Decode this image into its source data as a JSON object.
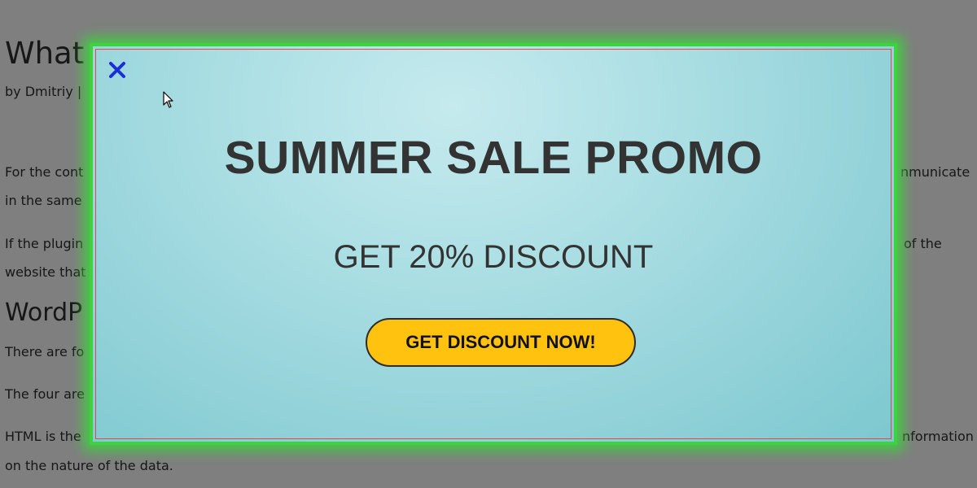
{
  "article": {
    "title_fragment": "What",
    "byline_fragment": "by Dmitriy  |",
    "p1_left": "For the cont",
    "p1_right": "nmunicate",
    "p1_line2": "in the same",
    "p2_left": "If the plugin",
    "p2_right": "of the",
    "p2_line2": "website that",
    "h2_fragment": "WordP",
    "p3_left": "There are fo",
    "p4_left": "The four are",
    "p5_left": "HTML is the",
    "p5_right": "nformation",
    "p5_line2": "on the nature of the data."
  },
  "popup": {
    "close_icon": "close-x-icon",
    "title": "SUMMER SALE PROMO",
    "subtitle": "GET 20% DISCOUNT",
    "cta_label": "GET DISCOUNT NOW!",
    "colors": {
      "glow_border": "#3ed23e",
      "inner_border": "#e0494a",
      "close_icon": "#1a2fd6",
      "cta_background": "#ffc20e",
      "text": "#333333"
    }
  }
}
